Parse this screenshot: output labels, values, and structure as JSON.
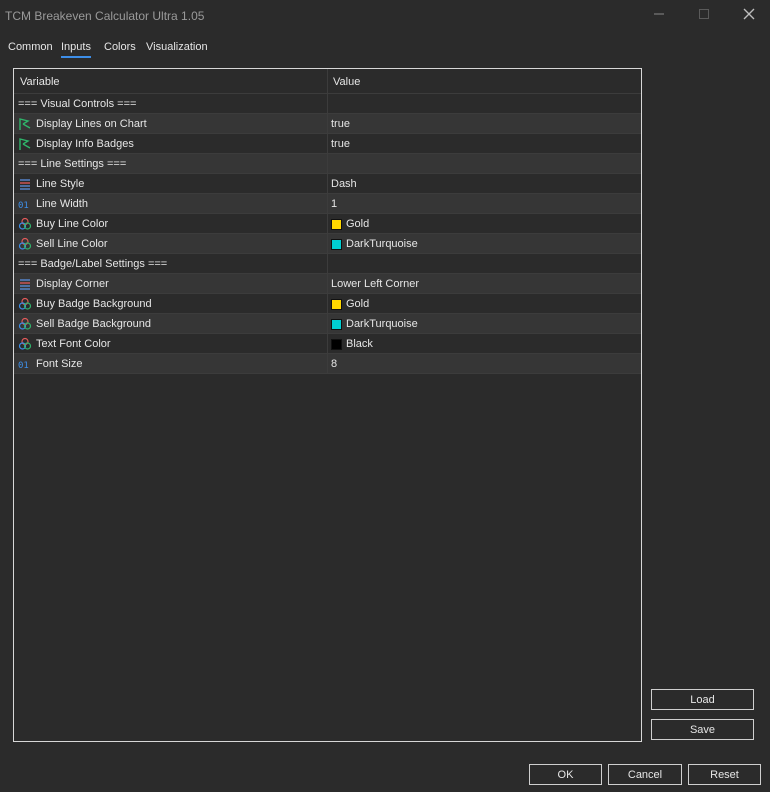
{
  "window": {
    "title": "TCM Breakeven Calculator Ultra 1.05"
  },
  "tabs": [
    {
      "label": "Common",
      "active": false
    },
    {
      "label": "Inputs",
      "active": true
    },
    {
      "label": "Colors",
      "active": false
    },
    {
      "label": "Visualization",
      "active": false
    }
  ],
  "grid": {
    "header": {
      "variable": "Variable",
      "value": "Value"
    },
    "rows": [
      {
        "variable": "=== Visual Controls ===",
        "value": "",
        "icon": "",
        "swatch": ""
      },
      {
        "variable": "Display Lines on Chart",
        "value": "true",
        "icon": "bool-flag-icon",
        "swatch": ""
      },
      {
        "variable": "Display Info Badges",
        "value": "true",
        "icon": "bool-flag-icon",
        "swatch": ""
      },
      {
        "variable": "=== Line Settings ===",
        "value": "",
        "icon": "",
        "swatch": ""
      },
      {
        "variable": "Line Style",
        "value": "Dash",
        "icon": "enum-list-icon",
        "swatch": ""
      },
      {
        "variable": "Line Width",
        "value": "1",
        "icon": "integer-icon",
        "swatch": ""
      },
      {
        "variable": "Buy Line Color",
        "value": "Gold",
        "icon": "color-icon",
        "swatch": "#FFD700"
      },
      {
        "variable": "Sell Line Color",
        "value": "DarkTurquoise",
        "icon": "color-icon",
        "swatch": "#00CED1"
      },
      {
        "variable": "=== Badge/Label Settings ===",
        "value": "",
        "icon": "",
        "swatch": ""
      },
      {
        "variable": "Display Corner",
        "value": "Lower Left Corner",
        "icon": "enum-list-icon",
        "swatch": ""
      },
      {
        "variable": "Buy Badge Background",
        "value": "Gold",
        "icon": "color-icon",
        "swatch": "#FFD700"
      },
      {
        "variable": "Sell Badge Background",
        "value": "DarkTurquoise",
        "icon": "color-icon",
        "swatch": "#00CED1"
      },
      {
        "variable": "Text Font Color",
        "value": "Black",
        "icon": "color-icon",
        "swatch": "#000000"
      },
      {
        "variable": "Font Size",
        "value": "8",
        "icon": "integer-icon",
        "swatch": ""
      }
    ]
  },
  "buttons": {
    "load": "Load",
    "save": "Save",
    "ok": "OK",
    "cancel": "Cancel",
    "reset": "Reset"
  },
  "colors": {
    "background": "#2b2b2b",
    "alt_row": "#363636",
    "active_tab_underline": "#3d8ee8",
    "bool_icon": "#2fb36a",
    "integer_icon": "#3d8ee8"
  }
}
